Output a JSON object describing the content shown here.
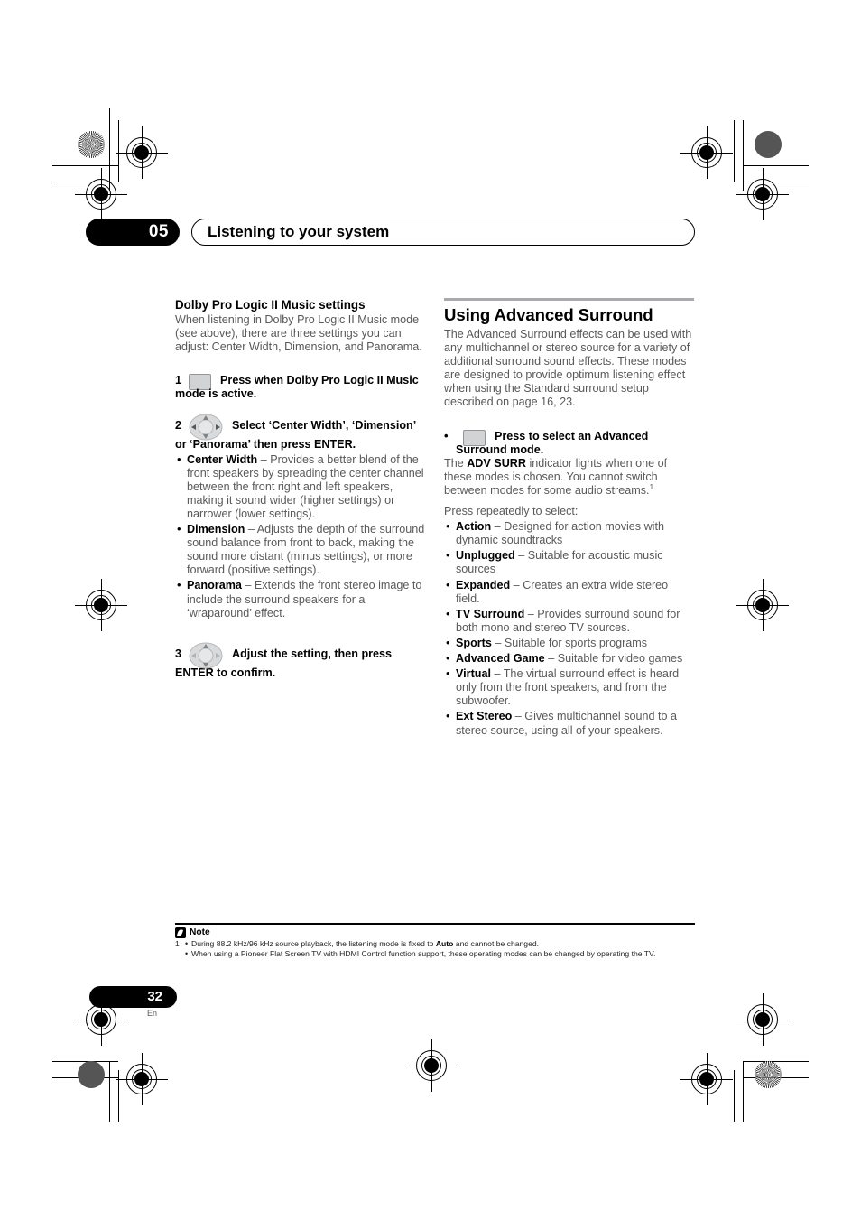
{
  "page": {
    "chapter_number": "05",
    "chapter_title": "Listening to your system",
    "page_number": "32",
    "language_code": "En"
  },
  "left_column": {
    "subheading": "Dolby Pro Logic II Music settings",
    "intro": "When listening in Dolby Pro Logic II Music mode (see above), there are three settings you can adjust: Center Width, Dimension, and Panorama.",
    "step1": {
      "number": "1",
      "icon": "remote-button-icon",
      "text": "Press when Dolby Pro Logic II Music mode is active."
    },
    "step2": {
      "number": "2",
      "icon": "joystick-pad-icon",
      "text": "Select ‘Center Width’, ‘Dimension’ or ‘Panorama’ then press ENTER."
    },
    "step2_bullets": [
      {
        "term": "Center Width",
        "description": " – Provides a better blend of the front speakers by spreading the center channel between the front right and left speakers, making it sound wider (higher settings) or narrower (lower settings)."
      },
      {
        "term": "Dimension",
        "description": " – Adjusts the depth of the surround sound balance from front to back, making the sound more distant (minus settings), or more forward (positive settings)."
      },
      {
        "term": "Panorama",
        "description": " – Extends the front stereo image to include the surround speakers for a ‘wraparound’ effect."
      }
    ],
    "step3": {
      "number": "3",
      "icon": "joystick-pad-icon",
      "text": "Adjust the setting, then press ENTER to confirm."
    }
  },
  "right_column": {
    "heading": "Using Advanced Surround",
    "intro": "The Advanced Surround effects can be used with any multichannel or stereo source for a variety of additional surround sound effects. These modes are designed to provide optimum listening effect when using the Standard surround setup described on page 16, 23.",
    "bullet_step": {
      "icon": "remote-button-icon",
      "text": "Press to select an Advanced Surround mode."
    },
    "indicator_note_pre": "The ",
    "indicator_name": "ADV SURR",
    "indicator_note_post": " indicator lights when one of these modes is chosen. You cannot switch between modes for some audio streams.",
    "footnote_marker": "1",
    "press_repeatedly": "Press repeatedly to select:",
    "modes": [
      {
        "term": "Action",
        "description": " – Designed for action movies with dynamic soundtracks"
      },
      {
        "term": "Unplugged",
        "description": " – Suitable for acoustic music sources"
      },
      {
        "term": "Expanded",
        "description": " – Creates an extra wide stereo field."
      },
      {
        "term": "TV Surround",
        "description": " – Provides surround sound for both mono and stereo TV sources."
      },
      {
        "term": "Sports",
        "description": " – Suitable for sports programs"
      },
      {
        "term": "Advanced Game",
        "description": " – Suitable for video games"
      },
      {
        "term": "Virtual",
        "description": " – The virtual surround effect is heard only from the front speakers, and from the subwoofer."
      },
      {
        "term": "Ext Stereo",
        "description": " – Gives multichannel sound to a stereo source, using all of your speakers."
      }
    ]
  },
  "note": {
    "label": "Note",
    "footnote_number": "1",
    "item1_pre": "During 88.2 kHz/96 kHz source playback, the listening mode is fixed to ",
    "item1_bold": "Auto",
    "item1_post": " and cannot be changed.",
    "item2": "When using a Pioneer Flat Screen TV with HDMI Control function support, these operating modes can be changed by operating the TV."
  }
}
